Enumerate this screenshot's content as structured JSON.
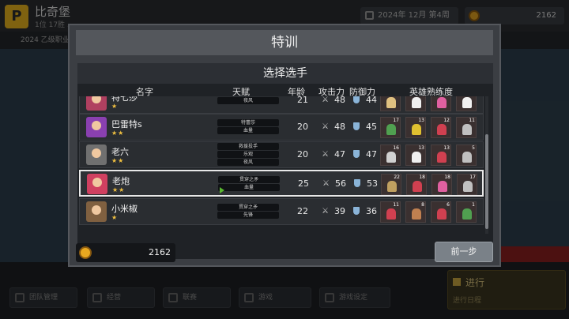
{
  "background": {
    "team_name": "比奇堡",
    "team_sub": "1位 17胜 ...",
    "date": "2024年 12月 第4周",
    "money": "2162",
    "notice": "2024 乙级职业...",
    "nav": [
      "团队管理",
      "经营",
      "联赛",
      "游戏",
      "游戏设定"
    ],
    "proceed_title": "进行",
    "proceed_sub": "进行日程"
  },
  "modal": {
    "title": "特训",
    "panel_title": "选择选手",
    "columns": {
      "name": "名字",
      "talent": "天赋",
      "age": "年龄",
      "attack": "攻击力",
      "defense": "防御力",
      "heroes": "英雄熟练度"
    },
    "money": "2162",
    "prev_button": "前一步"
  },
  "players": [
    {
      "name": "特七莎",
      "stars": "★",
      "talents": [
        "夜风"
      ],
      "age": "21",
      "attack": "48",
      "defense": "44",
      "avatar_color": "#b04060",
      "selected": false,
      "heroes": [
        {
          "lv": "",
          "color": "#e0c080"
        },
        {
          "lv": "",
          "color": "#f0f0f0"
        },
        {
          "lv": "",
          "color": "#e060a0"
        },
        {
          "lv": "",
          "color": "#f0f0f0"
        }
      ]
    },
    {
      "name": "巴雷特s",
      "stars": "★★",
      "talents": [
        "特蕾莎",
        "血量"
      ],
      "age": "20",
      "attack": "48",
      "defense": "45",
      "avatar_color": "#8a40b0",
      "selected": false,
      "heroes": [
        {
          "lv": "17",
          "color": "#50a050"
        },
        {
          "lv": "13",
          "color": "#e0c030"
        },
        {
          "lv": "12",
          "color": "#d04050"
        },
        {
          "lv": "11",
          "color": "#c0c0c0"
        }
      ]
    },
    {
      "name": "老六",
      "stars": "★★",
      "talents": [
        "救援投手",
        "乐观",
        "夜风"
      ],
      "age": "20",
      "attack": "47",
      "defense": "47",
      "avatar_color": "#707070",
      "selected": false,
      "heroes": [
        {
          "lv": "16",
          "color": "#d0d0d0"
        },
        {
          "lv": "13",
          "color": "#f0f0f0"
        },
        {
          "lv": "13",
          "color": "#d04050"
        },
        {
          "lv": "5",
          "color": "#c0c0c0"
        }
      ]
    },
    {
      "name": "老炮",
      "stars": "★★",
      "talents": [
        "贯穿之矛",
        "血量"
      ],
      "age": "25",
      "attack": "56",
      "defense": "53",
      "avatar_color": "#d04060",
      "selected": true,
      "heroes": [
        {
          "lv": "22",
          "color": "#c0a060"
        },
        {
          "lv": "18",
          "color": "#d04050"
        },
        {
          "lv": "18",
          "color": "#e060a0"
        },
        {
          "lv": "17",
          "color": "#c0c0c0"
        }
      ]
    },
    {
      "name": "小米椒",
      "stars": "★",
      "talents": [
        "贯穿之矛",
        "先锋"
      ],
      "age": "22",
      "attack": "39",
      "defense": "36",
      "avatar_color": "#806040",
      "selected": false,
      "heroes": [
        {
          "lv": "11",
          "color": "#d04050"
        },
        {
          "lv": "8",
          "color": "#c08050"
        },
        {
          "lv": "6",
          "color": "#d04050"
        },
        {
          "lv": "1",
          "color": "#50a050"
        }
      ]
    }
  ]
}
